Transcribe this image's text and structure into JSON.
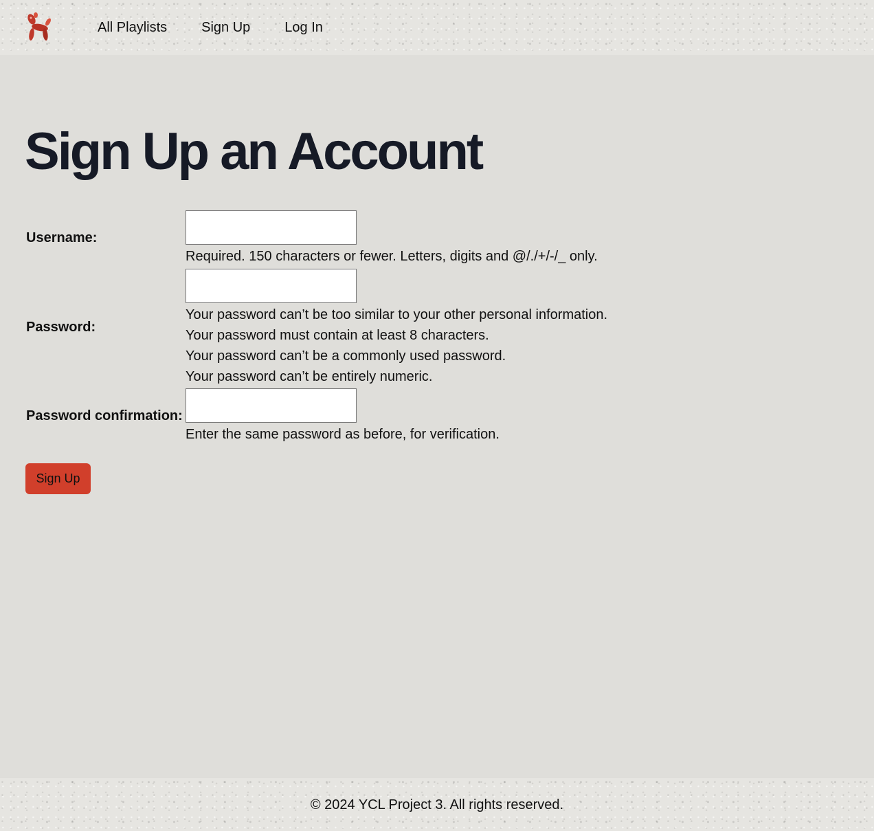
{
  "nav": {
    "logo": "balloon-dog-logo",
    "items": [
      {
        "label": "All Playlists"
      },
      {
        "label": "Sign Up"
      },
      {
        "label": "Log In"
      }
    ]
  },
  "page": {
    "title": "Sign Up an Account"
  },
  "form": {
    "username": {
      "label": "Username:",
      "value": "",
      "help": "Required. 150 characters or fewer. Letters, digits and @/./+/-/_ only."
    },
    "password": {
      "label": "Password:",
      "value": "",
      "help": [
        "Your password can’t be too similar to your other personal information.",
        "Your password must contain at least 8 characters.",
        "Your password can’t be a commonly used password.",
        "Your password can’t be entirely numeric."
      ]
    },
    "password_confirmation": {
      "label": "Password confirmation:",
      "value": "",
      "help": "Enter the same password as before, for verification."
    },
    "submit_label": "Sign Up"
  },
  "footer": {
    "text": "© 2024 YCL Project 3. All rights reserved."
  },
  "colors": {
    "background": "#dfdeda",
    "accent": "#d13f2b",
    "title": "#161a26"
  }
}
